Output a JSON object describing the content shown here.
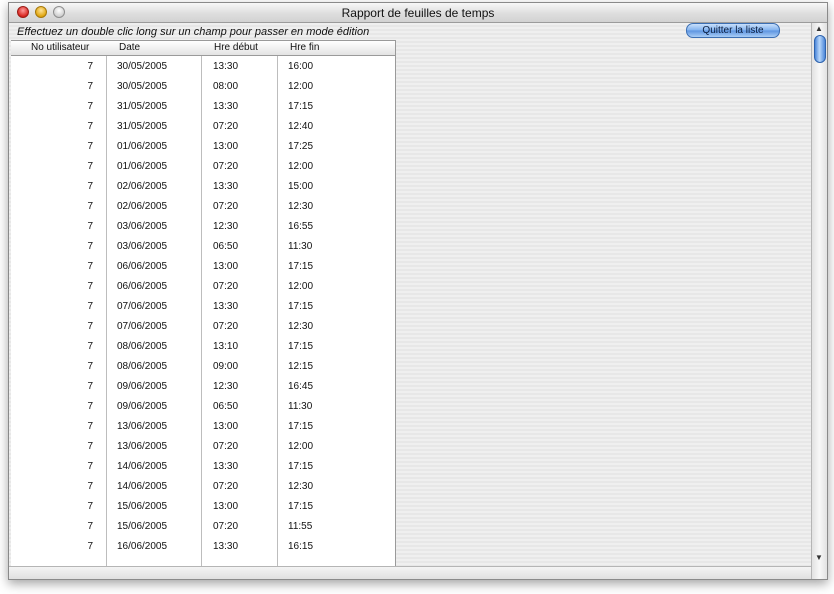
{
  "window": {
    "title": "Rapport de feuilles de temps"
  },
  "toolbar": {
    "instruction": "Effectuez un double clic long sur un champ pour passer en mode édition",
    "quit_label": "Quitter la liste"
  },
  "table": {
    "headers": [
      "No utilisateur",
      "Date",
      "Hre début",
      "Hre fin"
    ],
    "rows": [
      [
        "7",
        "30/05/2005",
        "13:30",
        "16:00"
      ],
      [
        "7",
        "30/05/2005",
        "08:00",
        "12:00"
      ],
      [
        "7",
        "31/05/2005",
        "13:30",
        "17:15"
      ],
      [
        "7",
        "31/05/2005",
        "07:20",
        "12:40"
      ],
      [
        "7",
        "01/06/2005",
        "13:00",
        "17:25"
      ],
      [
        "7",
        "01/06/2005",
        "07:20",
        "12:00"
      ],
      [
        "7",
        "02/06/2005",
        "13:30",
        "15:00"
      ],
      [
        "7",
        "02/06/2005",
        "07:20",
        "12:30"
      ],
      [
        "7",
        "03/06/2005",
        "12:30",
        "16:55"
      ],
      [
        "7",
        "03/06/2005",
        "06:50",
        "11:30"
      ],
      [
        "7",
        "06/06/2005",
        "13:00",
        "17:15"
      ],
      [
        "7",
        "06/06/2005",
        "07:20",
        "12:00"
      ],
      [
        "7",
        "07/06/2005",
        "13:30",
        "17:15"
      ],
      [
        "7",
        "07/06/2005",
        "07:20",
        "12:30"
      ],
      [
        "7",
        "08/06/2005",
        "13:10",
        "17:15"
      ],
      [
        "7",
        "08/06/2005",
        "09:00",
        "12:15"
      ],
      [
        "7",
        "09/06/2005",
        "12:30",
        "16:45"
      ],
      [
        "7",
        "09/06/2005",
        "06:50",
        "11:30"
      ],
      [
        "7",
        "13/06/2005",
        "13:00",
        "17:15"
      ],
      [
        "7",
        "13/06/2005",
        "07:20",
        "12:00"
      ],
      [
        "7",
        "14/06/2005",
        "13:30",
        "17:15"
      ],
      [
        "7",
        "14/06/2005",
        "07:20",
        "12:30"
      ],
      [
        "7",
        "15/06/2005",
        "13:00",
        "17:15"
      ],
      [
        "7",
        "15/06/2005",
        "07:20",
        "11:55"
      ],
      [
        "7",
        "16/06/2005",
        "13:30",
        "16:15"
      ]
    ]
  },
  "scrollbar": {
    "up_arrow": "▲",
    "down_arrow": "▼"
  }
}
